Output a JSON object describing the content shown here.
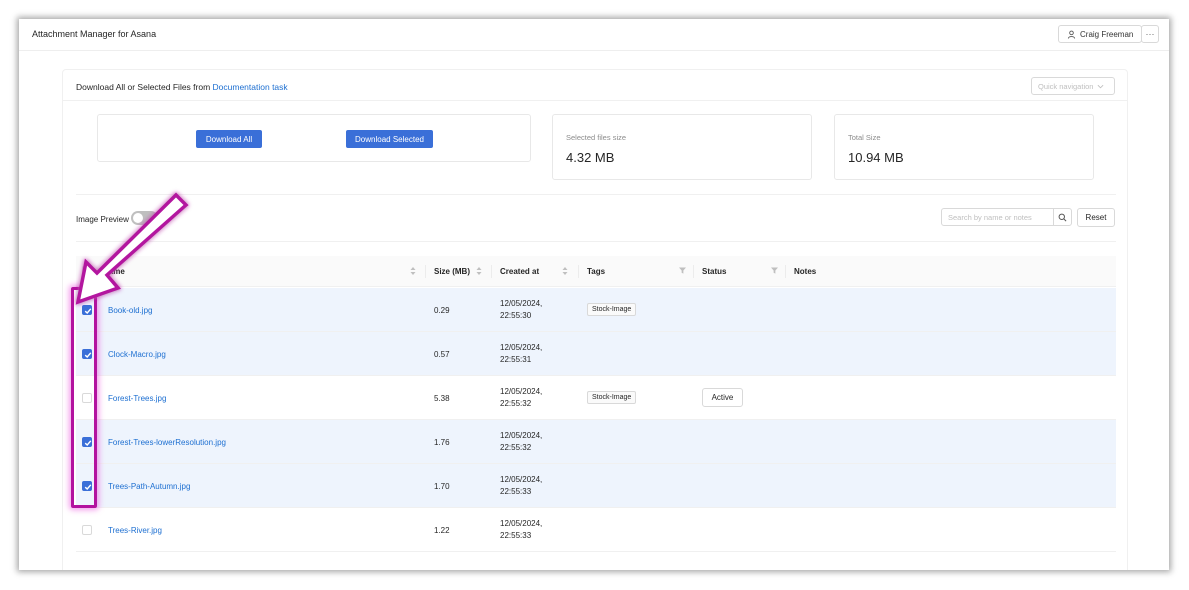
{
  "app": {
    "title": "Attachment Manager for Asana",
    "user_name": "Craig Freeman",
    "more_label": "···"
  },
  "header": {
    "title_prefix": "Download All or Selected Files from ",
    "task_link": "Documentation task",
    "quick_nav_placeholder": "Quick navigation"
  },
  "actions": {
    "download_all": "Download All",
    "download_selected": "Download Selected"
  },
  "stats": {
    "selected_label": "Selected files size",
    "selected_value": "4.32 MB",
    "total_label": "Total Size",
    "total_value": "10.94 MB"
  },
  "toolbar": {
    "image_preview_label": "Image Preview",
    "image_preview_on": false,
    "search_placeholder": "Search by name or notes",
    "reset_label": "Reset"
  },
  "table": {
    "columns": {
      "name": "Name",
      "size": "Size (MB)",
      "created": "Created at",
      "tags": "Tags",
      "status": "Status",
      "notes": "Notes"
    },
    "rows": [
      {
        "selected": true,
        "name": "Book-old.jpg",
        "size": "0.29",
        "date": "12/05/2024,",
        "time": "22:55:30",
        "tag": "Stock-Image",
        "status": ""
      },
      {
        "selected": true,
        "name": "Clock-Macro.jpg",
        "size": "0.57",
        "date": "12/05/2024,",
        "time": "22:55:31",
        "tag": "",
        "status": ""
      },
      {
        "selected": false,
        "name": "Forest-Trees.jpg",
        "size": "5.38",
        "date": "12/05/2024,",
        "time": "22:55:32",
        "tag": "Stock-Image",
        "status": "Active"
      },
      {
        "selected": true,
        "name": "Forest-Trees-lowerResolution.jpg",
        "size": "1.76",
        "date": "12/05/2024,",
        "time": "22:55:32",
        "tag": "",
        "status": ""
      },
      {
        "selected": true,
        "name": "Trees-Path-Autumn.jpg",
        "size": "1.70",
        "date": "12/05/2024,",
        "time": "22:55:33",
        "tag": "",
        "status": ""
      },
      {
        "selected": false,
        "name": "Trees-River.jpg",
        "size": "1.22",
        "date": "12/05/2024,",
        "time": "22:55:33",
        "tag": "",
        "status": ""
      }
    ]
  },
  "colors": {
    "primary": "#3a6fd8",
    "link": "#1d6fd1",
    "selected_row": "#eef4fd",
    "annotation": "#b3129f"
  }
}
